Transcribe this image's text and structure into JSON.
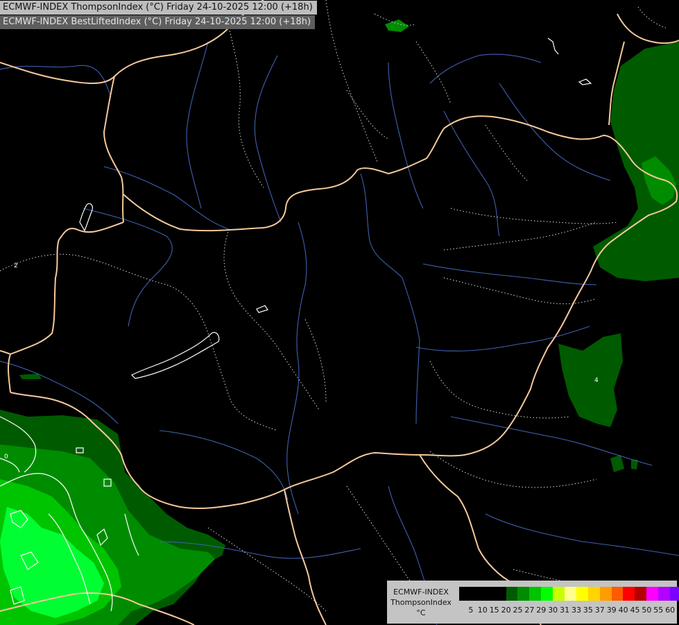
{
  "header": {
    "line1": "ECMWF-INDEX ThompsonIndex (°C) Friday 24-10-2025 12:00 (+18h)",
    "line2": "ECMWF-INDEX BestLiftedIndex (°C) Friday 24-10-2025 12:00 (+18h)"
  },
  "legend": {
    "title": [
      "ECMWF-INDEX",
      "ThompsonIndex",
      "°C"
    ],
    "colors": [
      "#000000",
      "#000000",
      "#000000",
      "#000000",
      "#005b00",
      "#008c00",
      "#00c400",
      "#00ff00",
      "#c8ff00",
      "#ffff8c",
      "#ffff00",
      "#ffd400",
      "#ff9c00",
      "#ff5a00",
      "#ff0000",
      "#b50000",
      "#ff00ff",
      "#b400ff",
      "#7b00ff",
      "#4a00ff",
      "#0000ff"
    ],
    "ticks": [
      "5",
      "10",
      "15",
      "20",
      "25",
      "27",
      "29",
      "30",
      "31",
      "33",
      "35",
      "37",
      "39",
      "40",
      "45",
      "50",
      "55",
      "60"
    ]
  },
  "map_colors": {
    "dark_green": "#006400",
    "mid_green": "#009600",
    "light_green": "#00d200",
    "bright_green": "#00ff32",
    "border": "#f5c99b",
    "river": "#4060b0",
    "contour": "#ffffff"
  },
  "contour_labels": [
    "4",
    "2",
    "0"
  ]
}
